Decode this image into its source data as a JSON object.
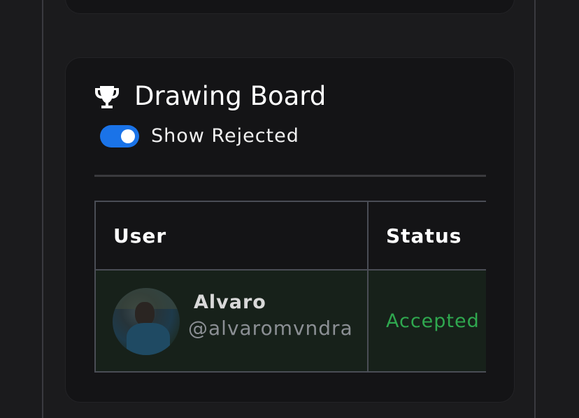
{
  "card": {
    "title": "Drawing Board",
    "trophy_icon": "trophy-icon",
    "toggle": {
      "label": "Show Rejected",
      "checked": true,
      "color": "#1a73e8"
    }
  },
  "table": {
    "headers": [
      "User",
      "Status"
    ],
    "rows": [
      {
        "name": "Alvaro",
        "handle": "@alvaromvndra",
        "status": "Accepted ",
        "status_color": "#2fa84f"
      }
    ]
  }
}
